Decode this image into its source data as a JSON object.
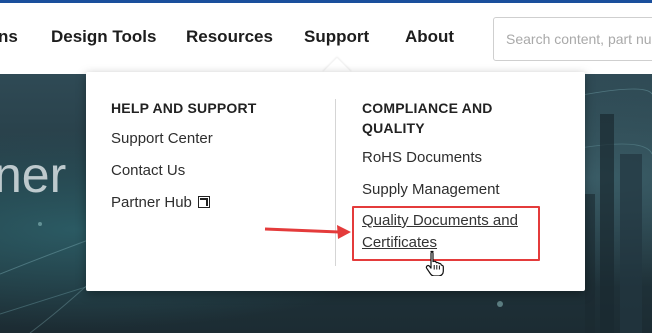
{
  "nav": {
    "items": [
      "ns",
      "Design Tools",
      "Resources",
      "Support",
      "About"
    ],
    "search_placeholder": "Search content, part nu"
  },
  "hero": {
    "text": "ner"
  },
  "dropdown": {
    "left_heading": "HELP AND SUPPORT",
    "left_links": [
      "Support Center",
      "Contact Us",
      "Partner Hub"
    ],
    "right_heading_line1": "COMPLIANCE AND",
    "right_heading_line2": "QUALITY",
    "right_links": [
      "RoHS Documents",
      "Supply Management"
    ],
    "highlight_link_line1": "Quality Documents and",
    "highlight_link_line2": "Certificates"
  },
  "icons": {
    "external": "external-link-icon",
    "cursor": "hand-pointer-icon",
    "annotation": "red-arrow-icon"
  },
  "colors": {
    "top_line": "#1a4f9c",
    "annotation_red": "#e43b3b"
  }
}
